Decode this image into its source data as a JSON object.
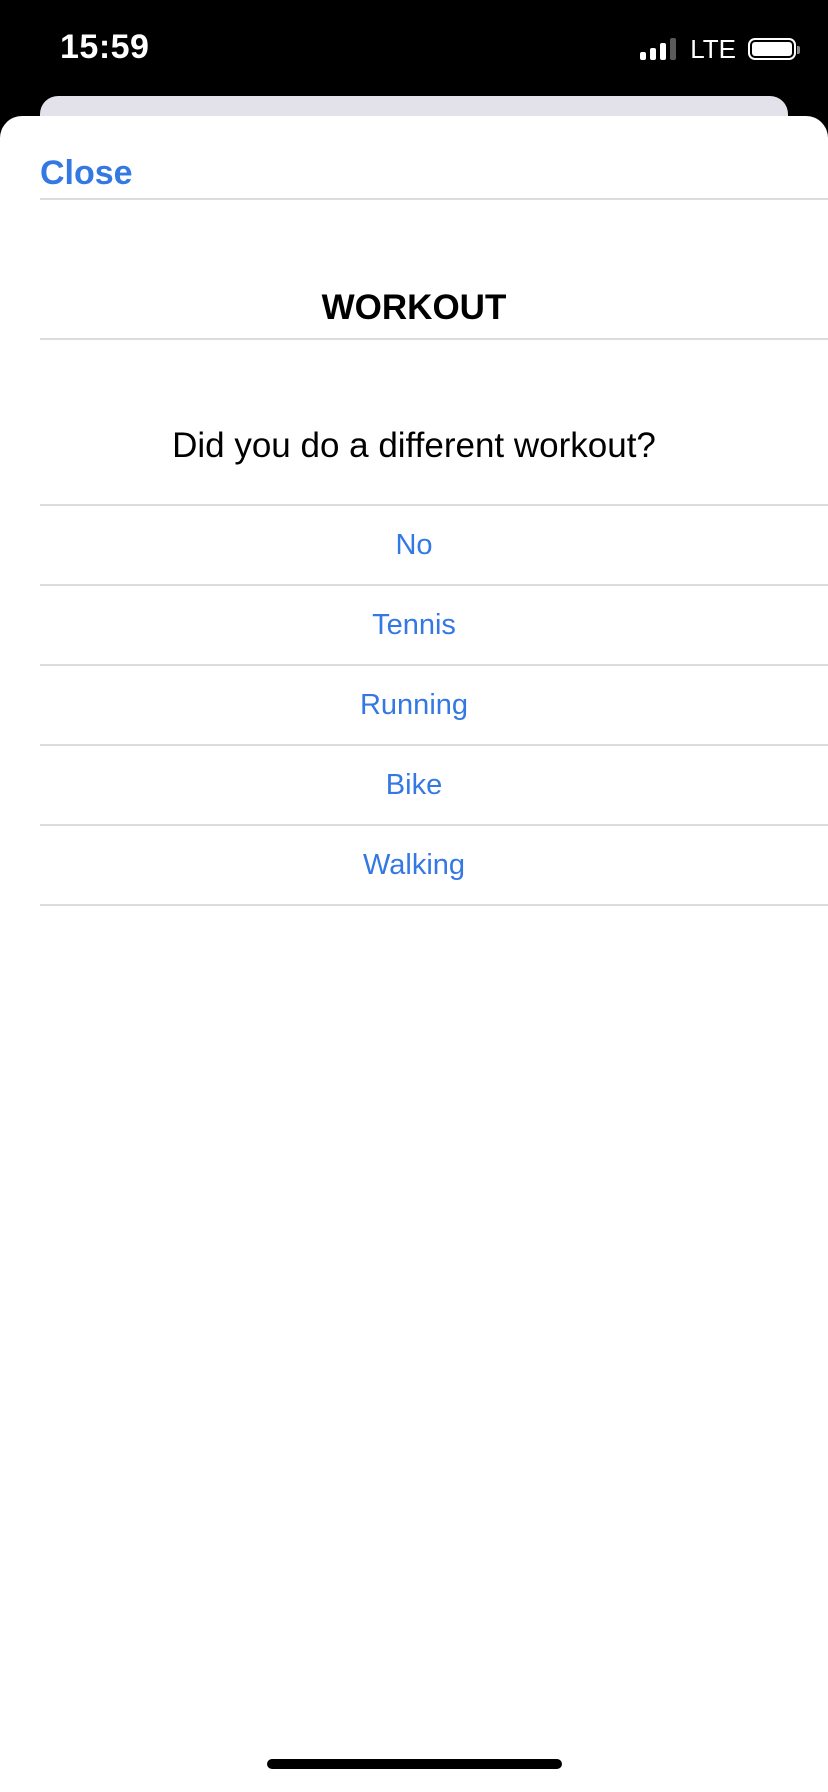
{
  "status_bar": {
    "time": "15:59",
    "network": "LTE"
  },
  "sheet": {
    "close_label": "Close",
    "title": "WORKOUT",
    "question": "Did you do a different workout?",
    "options": [
      {
        "label": "No"
      },
      {
        "label": "Tennis"
      },
      {
        "label": "Running"
      },
      {
        "label": "Bike"
      },
      {
        "label": "Walking"
      }
    ]
  },
  "colors": {
    "accent": "#3478e4",
    "background": "#ffffff",
    "divider": "#dcdcdc"
  }
}
